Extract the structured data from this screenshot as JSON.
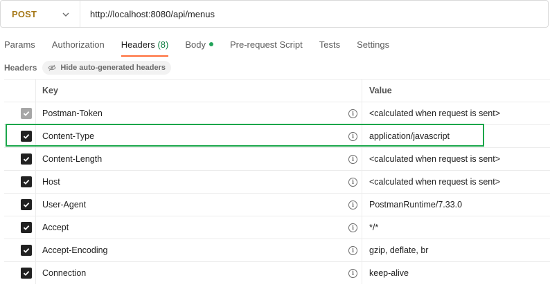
{
  "request": {
    "method": "POST",
    "url": "http://localhost:8080/api/menus"
  },
  "tabs": [
    {
      "label": "Params"
    },
    {
      "label": "Authorization"
    },
    {
      "label": "Headers",
      "count": "(8)"
    },
    {
      "label": "Body"
    },
    {
      "label": "Pre-request Script"
    },
    {
      "label": "Tests"
    },
    {
      "label": "Settings"
    }
  ],
  "headers_section": {
    "title": "Headers",
    "hide_button": "Hide auto-generated headers"
  },
  "table": {
    "columns": {
      "key": "Key",
      "value": "Value"
    },
    "rows": [
      {
        "key": "Postman-Token",
        "value": "<calculated when request is sent>",
        "checked": true,
        "disabled": true
      },
      {
        "key": "Content-Type",
        "value": "application/javascript",
        "checked": true,
        "disabled": false
      },
      {
        "key": "Content-Length",
        "value": "<calculated when request is sent>",
        "checked": true,
        "disabled": false
      },
      {
        "key": "Host",
        "value": "<calculated when request is sent>",
        "checked": true,
        "disabled": false
      },
      {
        "key": "User-Agent",
        "value": "PostmanRuntime/7.33.0",
        "checked": true,
        "disabled": false
      },
      {
        "key": "Accept",
        "value": "*/*",
        "checked": true,
        "disabled": false
      },
      {
        "key": "Accept-Encoding",
        "value": "gzip, deflate, br",
        "checked": true,
        "disabled": false
      },
      {
        "key": "Connection",
        "value": "keep-alive",
        "checked": true,
        "disabled": false
      }
    ]
  },
  "colors": {
    "method": "#a6791a",
    "active_tab_underline": "#ff6c37",
    "count": "#0a7d3e",
    "highlight": "#1aa64a"
  },
  "icons": {
    "method_dropdown": "chevron-down-icon",
    "hide_chip": "eye-slash-icon",
    "row_info": "info-icon",
    "checkbox": "check-icon"
  }
}
